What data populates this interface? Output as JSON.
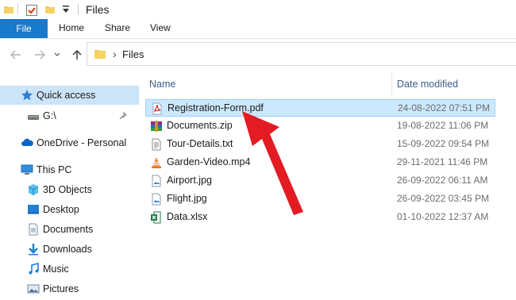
{
  "window": {
    "title": "Files"
  },
  "quick_access_toolbar": {
    "icons": [
      "folder-icon",
      "properties-check-icon",
      "new-folder-icon",
      "customize-dropdown-icon"
    ]
  },
  "ribbon": {
    "tabs": [
      "File",
      "Home",
      "Share",
      "View"
    ]
  },
  "address_bar": {
    "path": [
      "Files"
    ]
  },
  "columns": {
    "name": "Name",
    "date": "Date modified"
  },
  "sidebar": {
    "items": [
      {
        "label": "Quick access",
        "icon": "star-icon"
      },
      {
        "label": "G:\\",
        "icon": "drive-icon"
      },
      {
        "label": "OneDrive - Personal",
        "icon": "onedrive-cloud-icon"
      },
      {
        "label": "This PC",
        "icon": "computer-icon"
      },
      {
        "label": "3D Objects",
        "icon": "cube-icon"
      },
      {
        "label": "Desktop",
        "icon": "desktop-icon"
      },
      {
        "label": "Documents",
        "icon": "documents-icon"
      },
      {
        "label": "Downloads",
        "icon": "downloads-icon"
      },
      {
        "label": "Music",
        "icon": "music-icon"
      },
      {
        "label": "Pictures",
        "icon": "pictures-icon"
      }
    ]
  },
  "files": [
    {
      "name": "Registration-Form.pdf",
      "date": "24-08-2022 07:51 PM",
      "icon": "pdf-icon"
    },
    {
      "name": "Documents.zip",
      "date": "19-08-2022 11:06 PM",
      "icon": "zip-archive-icon"
    },
    {
      "name": "Tour-Details.txt",
      "date": "15-09-2022 09:54 PM",
      "icon": "text-file-icon"
    },
    {
      "name": "Garden-Video.mp4",
      "date": "29-11-2021 11:46 PM",
      "icon": "vlc-video-icon"
    },
    {
      "name": "Airport.jpg",
      "date": "26-09-2022 06:11 AM",
      "icon": "image-file-icon"
    },
    {
      "name": "Flight.jpg",
      "date": "26-09-2022 03:45 PM",
      "icon": "image-file-icon"
    },
    {
      "name": "Data.xlsx",
      "date": "01-10-2022 12:37 AM",
      "icon": "excel-icon"
    }
  ],
  "colors": {
    "accent": "#1979ca",
    "selection": "#cce8ff",
    "annotation_arrow": "#e31b23"
  }
}
